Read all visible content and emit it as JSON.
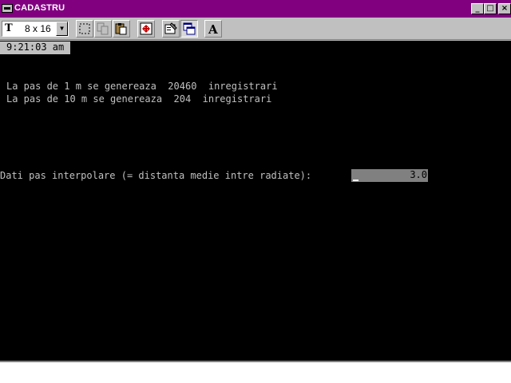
{
  "window": {
    "title": "CADASTRU",
    "controls": {
      "minimize": "_",
      "maximize": "□",
      "close": "×"
    }
  },
  "toolbar": {
    "font_size": "8 x 16",
    "tools": [
      "mark-icon",
      "copy-icon",
      "paste-icon",
      "fullscreen-icon",
      "properties-icon",
      "background-icon",
      "font-icon"
    ],
    "font_button_glyph": "A"
  },
  "console": {
    "clock": "9:21:03 am",
    "lines": [
      "La pas de 1 m se genereaza  20460  inregistrari",
      "La pas de 10 m se genereaza  204  inregistrari"
    ],
    "prompt": "Dati pas interpolare (= distanta medie intre radiate):",
    "input_value": "3.0"
  },
  "colors": {
    "titlebar": "#800080",
    "console_bg": "#000000",
    "console_text": "#c0c0c0",
    "input_bg": "#808080"
  }
}
